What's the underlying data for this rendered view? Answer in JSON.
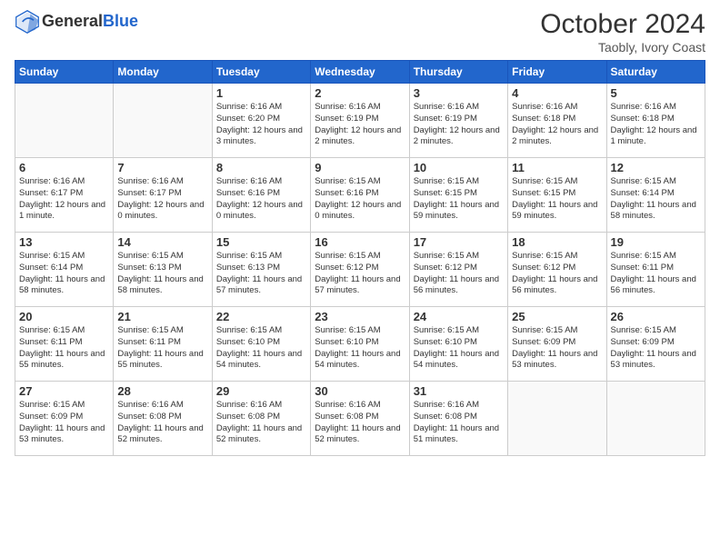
{
  "header": {
    "logo_general": "General",
    "logo_blue": "Blue",
    "month_year": "October 2024",
    "location": "Taobly, Ivory Coast"
  },
  "weekdays": [
    "Sunday",
    "Monday",
    "Tuesday",
    "Wednesday",
    "Thursday",
    "Friday",
    "Saturday"
  ],
  "weeks": [
    [
      {
        "day": "",
        "info": ""
      },
      {
        "day": "",
        "info": ""
      },
      {
        "day": "1",
        "info": "Sunrise: 6:16 AM\nSunset: 6:20 PM\nDaylight: 12 hours\nand 3 minutes."
      },
      {
        "day": "2",
        "info": "Sunrise: 6:16 AM\nSunset: 6:19 PM\nDaylight: 12 hours\nand 2 minutes."
      },
      {
        "day": "3",
        "info": "Sunrise: 6:16 AM\nSunset: 6:19 PM\nDaylight: 12 hours\nand 2 minutes."
      },
      {
        "day": "4",
        "info": "Sunrise: 6:16 AM\nSunset: 6:18 PM\nDaylight: 12 hours\nand 2 minutes."
      },
      {
        "day": "5",
        "info": "Sunrise: 6:16 AM\nSunset: 6:18 PM\nDaylight: 12 hours\nand 1 minute."
      }
    ],
    [
      {
        "day": "6",
        "info": "Sunrise: 6:16 AM\nSunset: 6:17 PM\nDaylight: 12 hours\nand 1 minute."
      },
      {
        "day": "7",
        "info": "Sunrise: 6:16 AM\nSunset: 6:17 PM\nDaylight: 12 hours\nand 0 minutes."
      },
      {
        "day": "8",
        "info": "Sunrise: 6:16 AM\nSunset: 6:16 PM\nDaylight: 12 hours\nand 0 minutes."
      },
      {
        "day": "9",
        "info": "Sunrise: 6:15 AM\nSunset: 6:16 PM\nDaylight: 12 hours\nand 0 minutes."
      },
      {
        "day": "10",
        "info": "Sunrise: 6:15 AM\nSunset: 6:15 PM\nDaylight: 11 hours\nand 59 minutes."
      },
      {
        "day": "11",
        "info": "Sunrise: 6:15 AM\nSunset: 6:15 PM\nDaylight: 11 hours\nand 59 minutes."
      },
      {
        "day": "12",
        "info": "Sunrise: 6:15 AM\nSunset: 6:14 PM\nDaylight: 11 hours\nand 58 minutes."
      }
    ],
    [
      {
        "day": "13",
        "info": "Sunrise: 6:15 AM\nSunset: 6:14 PM\nDaylight: 11 hours\nand 58 minutes."
      },
      {
        "day": "14",
        "info": "Sunrise: 6:15 AM\nSunset: 6:13 PM\nDaylight: 11 hours\nand 58 minutes."
      },
      {
        "day": "15",
        "info": "Sunrise: 6:15 AM\nSunset: 6:13 PM\nDaylight: 11 hours\nand 57 minutes."
      },
      {
        "day": "16",
        "info": "Sunrise: 6:15 AM\nSunset: 6:12 PM\nDaylight: 11 hours\nand 57 minutes."
      },
      {
        "day": "17",
        "info": "Sunrise: 6:15 AM\nSunset: 6:12 PM\nDaylight: 11 hours\nand 56 minutes."
      },
      {
        "day": "18",
        "info": "Sunrise: 6:15 AM\nSunset: 6:12 PM\nDaylight: 11 hours\nand 56 minutes."
      },
      {
        "day": "19",
        "info": "Sunrise: 6:15 AM\nSunset: 6:11 PM\nDaylight: 11 hours\nand 56 minutes."
      }
    ],
    [
      {
        "day": "20",
        "info": "Sunrise: 6:15 AM\nSunset: 6:11 PM\nDaylight: 11 hours\nand 55 minutes."
      },
      {
        "day": "21",
        "info": "Sunrise: 6:15 AM\nSunset: 6:11 PM\nDaylight: 11 hours\nand 55 minutes."
      },
      {
        "day": "22",
        "info": "Sunrise: 6:15 AM\nSunset: 6:10 PM\nDaylight: 11 hours\nand 54 minutes."
      },
      {
        "day": "23",
        "info": "Sunrise: 6:15 AM\nSunset: 6:10 PM\nDaylight: 11 hours\nand 54 minutes."
      },
      {
        "day": "24",
        "info": "Sunrise: 6:15 AM\nSunset: 6:10 PM\nDaylight: 11 hours\nand 54 minutes."
      },
      {
        "day": "25",
        "info": "Sunrise: 6:15 AM\nSunset: 6:09 PM\nDaylight: 11 hours\nand 53 minutes."
      },
      {
        "day": "26",
        "info": "Sunrise: 6:15 AM\nSunset: 6:09 PM\nDaylight: 11 hours\nand 53 minutes."
      }
    ],
    [
      {
        "day": "27",
        "info": "Sunrise: 6:15 AM\nSunset: 6:09 PM\nDaylight: 11 hours\nand 53 minutes."
      },
      {
        "day": "28",
        "info": "Sunrise: 6:16 AM\nSunset: 6:08 PM\nDaylight: 11 hours\nand 52 minutes."
      },
      {
        "day": "29",
        "info": "Sunrise: 6:16 AM\nSunset: 6:08 PM\nDaylight: 11 hours\nand 52 minutes."
      },
      {
        "day": "30",
        "info": "Sunrise: 6:16 AM\nSunset: 6:08 PM\nDaylight: 11 hours\nand 52 minutes."
      },
      {
        "day": "31",
        "info": "Sunrise: 6:16 AM\nSunset: 6:08 PM\nDaylight: 11 hours\nand 51 minutes."
      },
      {
        "day": "",
        "info": ""
      },
      {
        "day": "",
        "info": ""
      }
    ]
  ]
}
